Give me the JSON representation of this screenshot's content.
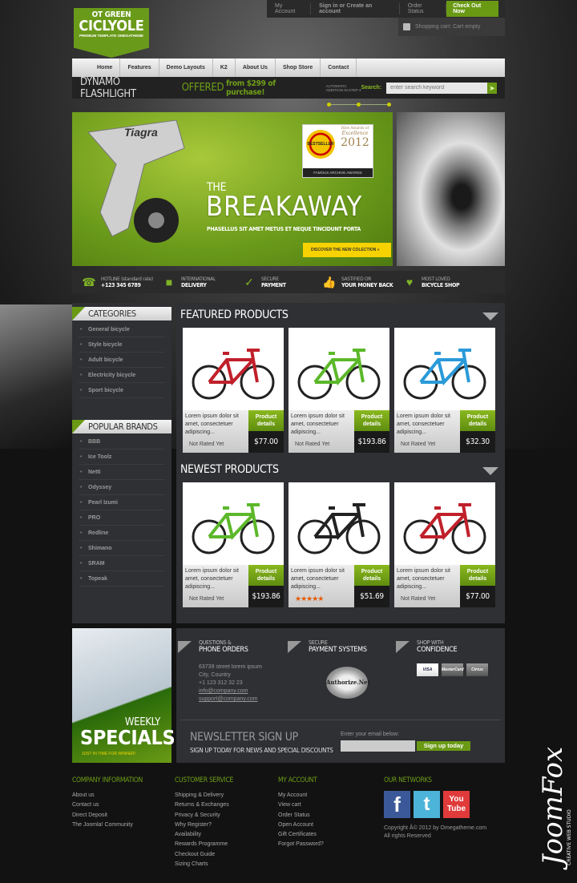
{
  "logo": {
    "line1": "OT GREEN",
    "line2": "CICLYOLE",
    "line3": "PREMIUM TEMPLATE OMEGATHEME"
  },
  "topbar": {
    "my_account": "My Account",
    "sign_in": "Sign in",
    "or": "or",
    "create": "Create an account",
    "order_status": "Order Status",
    "checkout": "Check Out Now",
    "cart": "Shopping cart: Cart empty"
  },
  "nav": [
    "Home",
    "Features",
    "Demo Layouts",
    "K2",
    "About Us",
    "Shop Store",
    "Contact"
  ],
  "promo": {
    "t1": "DYNAMO FLASHLIGHT",
    "t2": "OFFERED",
    "t3": "from $299 of purchase!",
    "t4": "AUTOMATIC ADDITION IN STEP 4",
    "search_label": "Search:",
    "search_placeholder": "enter search keyword"
  },
  "banner": {
    "badge": "BESTSELLER",
    "award1": "Hire Awards of",
    "award2": "Excellence",
    "award3": "2012",
    "award_caption": "FAMOUS ARCHIVE AWARDS",
    "the": "THE",
    "title": "BREAKAWAY",
    "subtitle": "PHASELLUS SIT AMET METUS ET NEQUE TINCIDUNT PORTA",
    "button": "DISCOVER THE NEW COLECTION",
    "product_brand": "Tiagra"
  },
  "features": [
    {
      "icon": "phone-icon",
      "a": "HOTLINE (standard rate)",
      "b": "+123 345 6789"
    },
    {
      "icon": "truck-icon",
      "a": "INTERNATIONAL",
      "b": "DELIVERY"
    },
    {
      "icon": "check-icon",
      "a": "SECURE",
      "b": "PAYMENT"
    },
    {
      "icon": "thumbs-up-icon",
      "a": "SASTIFIED OR",
      "b": "YOUR MONEY BACK"
    },
    {
      "icon": "heart-icon",
      "a": "MOST LOVED",
      "b": "BICYCLE SHOP"
    }
  ],
  "sidebar": {
    "categories_title": "CATEGORIES",
    "categories": [
      "General bicycle",
      "Style bicycle",
      "Adult bicycle",
      "Electricity bicycle",
      "Sport bicycle"
    ],
    "brands_title": "POPULAR BRANDS",
    "brands": [
      "BBB",
      "Ice Toolz",
      "Netti",
      "Odyssey",
      "Pearl Izumi",
      "PRO",
      "Redline",
      "Shimano",
      "SRAM",
      "Topeak"
    ]
  },
  "featured": {
    "title": "FEATURED PRODUCTS",
    "products": [
      {
        "desc": "Lorem ipsum dolor sit amet, consectetuer adipiscing...",
        "rating": "Not Rated Yet",
        "button": "Product details",
        "price": "$77.00",
        "color": "#c0202a"
      },
      {
        "desc": "Lorem ipsum dolor sit amet, consectetuer adipiscing...",
        "rating": "Not Rated Yet",
        "button": "Product details",
        "price": "$193.86",
        "color": "#5cb82a"
      },
      {
        "desc": "Lorem ipsum dolor sit amet, consectetuer adipiscing...",
        "rating": "Not Rated Yet",
        "button": "Product details",
        "price": "$32.30",
        "color": "#2a9ad8"
      }
    ]
  },
  "newest": {
    "title": "NEWEST PRODUCTS",
    "products": [
      {
        "desc": "Lorem ipsum dolor sit amet, consectetuer adipiscing...",
        "rating": "Not Rated Yet",
        "button": "Product details",
        "price": "$193.86",
        "color": "#5cb82a"
      },
      {
        "desc": "Lorem ipsum dolor sit amet, consectetuer adipiscing...",
        "stars": 5,
        "button": "Product details",
        "price": "$51.69",
        "color": "#222222"
      },
      {
        "desc": "Lorem ipsum dolor sit amet, consectetuer adipiscing...",
        "rating": "Not Rated Yet",
        "button": "Product details",
        "price": "$77.00",
        "color": "#c0202a"
      }
    ]
  },
  "weekly": {
    "w1": "WEEKLY",
    "w2": "SPECIALS",
    "w3": "JUST IN TIME FOR WINNER!"
  },
  "info": {
    "phone": {
      "a": "QUESTIONS &",
      "b": "PHONE ORDERS",
      "lines": [
        "63739 street lorem ipsum",
        "City, Country",
        "+1 123 312 32 23"
      ],
      "email1": "info@company.com",
      "email2": "support@company.com"
    },
    "payment": {
      "a": "SECURE",
      "b": "PAYMENT SYSTEMS",
      "seal": "Authorize.Net"
    },
    "confidence": {
      "a": "SHOP WITH",
      "b": "CONFIDENCE",
      "cards": [
        "VISA",
        "MasterCard",
        "Cirrus"
      ]
    }
  },
  "newsletter": {
    "title": "NEWSLETTER SIGN UP",
    "subtitle": "SIGN UP TODAY FOR NEWS AND SPECIAL DISCOUNTS",
    "email_label": "Enter your email below:",
    "button": "Sign up today"
  },
  "footer": {
    "company": {
      "title": "COMPANY INFORMATION",
      "items": [
        "About us",
        "Contact us",
        "Direct Deposit",
        "The Joomla! Community"
      ]
    },
    "service": {
      "title": "CUSTOMER SERVICE",
      "items": [
        "Shipping & Delivery",
        "Returns & Exchanges",
        "Privacy & Security",
        "Why Register?",
        "Availability",
        "Rewards Programme",
        "Checkout Guide",
        "Sizing Charts"
      ]
    },
    "account": {
      "title": "MY ACCOUNT",
      "items": [
        "My Account",
        "View cart",
        "Order Status",
        "Open Account",
        "Gift Certificates",
        "Forgot Password?"
      ]
    },
    "networks": {
      "title": "OUR NETWORKS",
      "social": [
        "f",
        "t",
        "You Tube"
      ],
      "copyright": "Copyright Â© 2012 by Omegatheme.com",
      "rights": "All rights Reserved"
    }
  },
  "watermark": {
    "brand": "JoomFox",
    "tag": "CREATIVE WEB STUDIO"
  },
  "colors": {
    "accent": "#6a9a14",
    "background": "#121212",
    "panel": "#2e3033"
  }
}
